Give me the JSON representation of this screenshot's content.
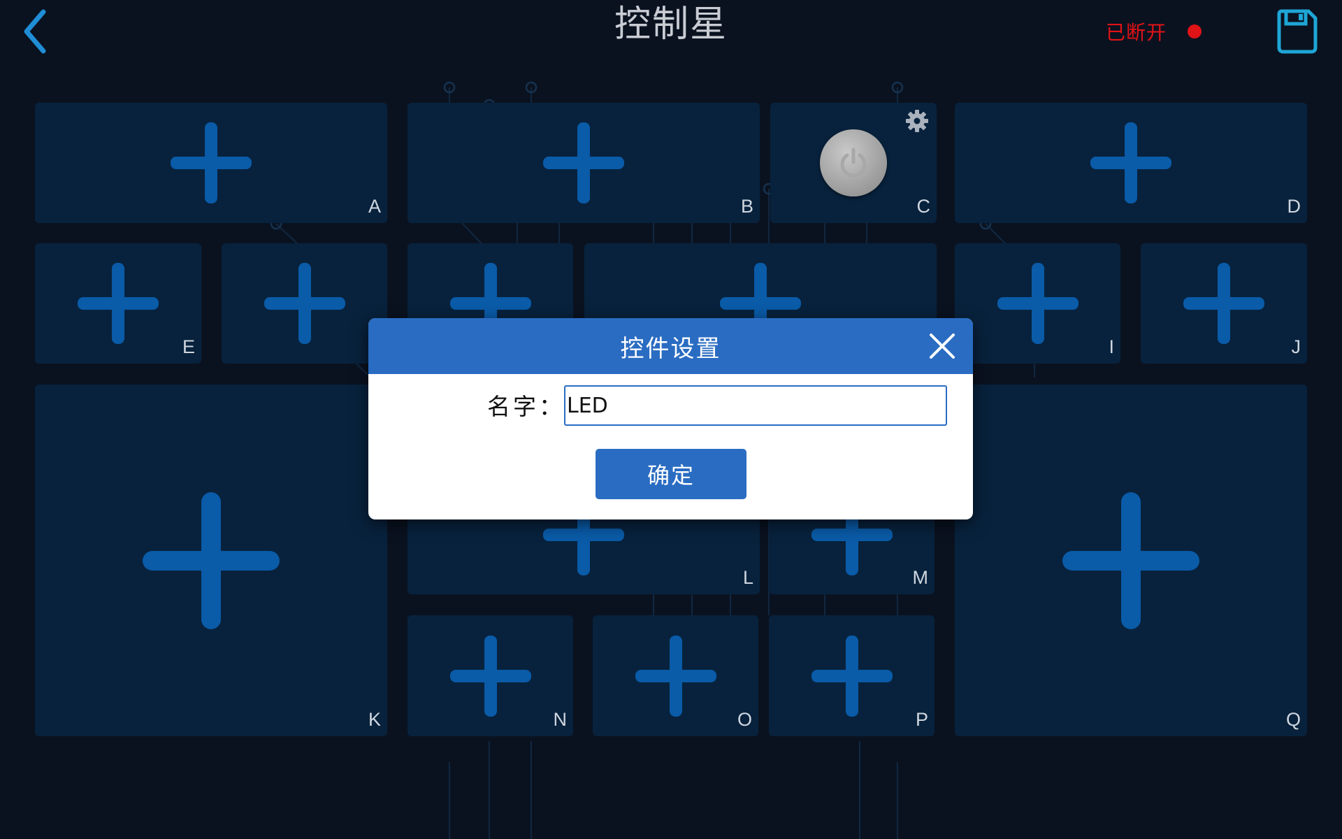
{
  "app": {
    "title": "控制星",
    "status_text": "已断开",
    "status_color": "#e01316",
    "accent_color": "#2a6cc2"
  },
  "icons": {
    "back": "chevron-left-icon",
    "save": "floppy-disk-icon",
    "add": "plus-icon",
    "settings": "gear-icon",
    "power": "power-icon",
    "close": "close-icon"
  },
  "grid": {
    "cells": [
      {
        "label": "A",
        "content": "add"
      },
      {
        "label": "B",
        "content": "add"
      },
      {
        "label": "C",
        "content": "power-switch"
      },
      {
        "label": "D",
        "content": "add"
      },
      {
        "label": "E",
        "content": "add"
      },
      {
        "label": "",
        "content": "add"
      },
      {
        "label": "",
        "content": "add"
      },
      {
        "label": "",
        "content": "add"
      },
      {
        "label": "I",
        "content": "add"
      },
      {
        "label": "J",
        "content": "add"
      },
      {
        "label": "K",
        "content": "add"
      },
      {
        "label": "L",
        "content": "add"
      },
      {
        "label": "M",
        "content": "add"
      },
      {
        "label": "Q",
        "content": "add"
      },
      {
        "label": "N",
        "content": "add"
      },
      {
        "label": "O",
        "content": "add"
      },
      {
        "label": "P",
        "content": "add"
      }
    ]
  },
  "dialog": {
    "title": "控件设置",
    "name_label": "名字：",
    "name_value": "LED",
    "confirm_label": "确定"
  }
}
